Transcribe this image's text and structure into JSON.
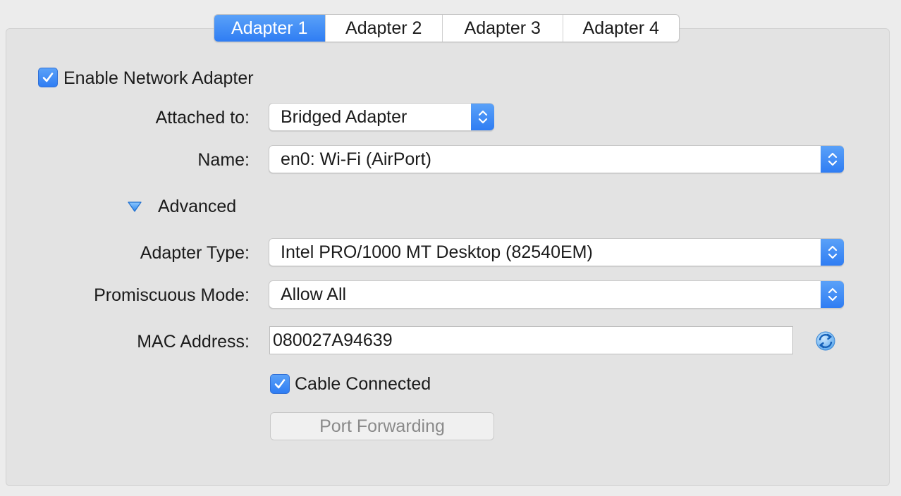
{
  "tabs": [
    {
      "label": "Adapter 1",
      "active": true
    },
    {
      "label": "Adapter 2",
      "active": false
    },
    {
      "label": "Adapter 3",
      "active": false
    },
    {
      "label": "Adapter 4",
      "active": false
    }
  ],
  "enable_adapter": {
    "label": "Enable Network Adapter",
    "checked": true
  },
  "attached_to": {
    "label": "Attached to:",
    "value": "Bridged Adapter"
  },
  "name": {
    "label": "Name:",
    "value": "en0: Wi-Fi (AirPort)"
  },
  "advanced": {
    "label": "Advanced",
    "expanded": true
  },
  "adapter_type": {
    "label": "Adapter Type:",
    "value": "Intel PRO/1000 MT Desktop (82540EM)"
  },
  "promiscuous_mode": {
    "label": "Promiscuous Mode:",
    "value": "Allow All"
  },
  "mac_address": {
    "label": "MAC Address:",
    "value": "080027A94639"
  },
  "cable_connected": {
    "label": "Cable Connected",
    "checked": true
  },
  "port_forwarding": {
    "label": "Port Forwarding",
    "enabled": false
  },
  "colors": {
    "accent": "#2f7df3",
    "panel": "#e3e3e3",
    "background": "#ececec"
  },
  "icons": {
    "refresh": "refresh-icon",
    "check": "checkmark-icon",
    "disclosure": "disclosure-triangle-icon",
    "popup_arrows": "chevron-up-down-icon"
  }
}
